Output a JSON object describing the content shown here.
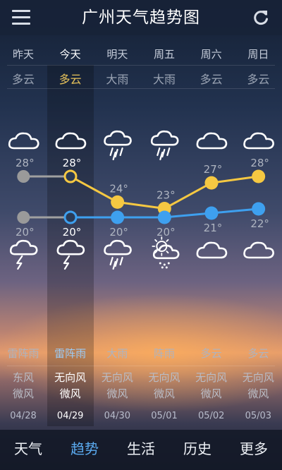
{
  "header": {
    "title": "广州天气趋势图",
    "menu_icon": "menu-icon",
    "refresh_icon": "refresh-icon"
  },
  "days": [
    {
      "name": "昨天",
      "cond_day": "多云",
      "icon_day": "cloud-icon",
      "high": "28°",
      "low": "20°",
      "icon_night": "thunderstorm-icon",
      "cond_night": "雷阵雨",
      "wind_dir": "东风",
      "wind_force": "微风",
      "date": "04/28"
    },
    {
      "name": "今天",
      "cond_day": "多云",
      "icon_day": "cloud-icon",
      "high": "28°",
      "low": "20°",
      "icon_night": "thunderstorm-icon",
      "cond_night": "雷阵雨",
      "wind_dir": "无向风",
      "wind_force": "微风",
      "date": "04/29"
    },
    {
      "name": "明天",
      "cond_day": "大雨",
      "icon_day": "heavy-rain-icon",
      "high": "24°",
      "low": "20°",
      "icon_night": "heavy-rain-icon",
      "cond_night": "大雨",
      "wind_dir": "无向风",
      "wind_force": "微风",
      "date": "04/30"
    },
    {
      "name": "周五",
      "cond_day": "大雨",
      "icon_day": "heavy-rain-icon",
      "high": "23°",
      "low": "20°",
      "icon_night": "shower-icon",
      "cond_night": "阵雨",
      "wind_dir": "无向风",
      "wind_force": "微风",
      "date": "05/01"
    },
    {
      "name": "周六",
      "cond_day": "多云",
      "icon_day": "cloud-icon",
      "high": "27°",
      "low": "21°",
      "icon_night": "cloud-icon",
      "cond_night": "多云",
      "wind_dir": "无向风",
      "wind_force": "微风",
      "date": "05/02"
    },
    {
      "name": "周日",
      "cond_day": "多云",
      "icon_day": "cloud-icon",
      "high": "28°",
      "low": "22°",
      "icon_night": "cloud-icon",
      "cond_night": "多云",
      "wind_dir": "无向风",
      "wind_force": "微风",
      "date": "05/03"
    }
  ],
  "chart_data": {
    "type": "line",
    "categories": [
      "昨天",
      "今天",
      "明天",
      "周五",
      "周六",
      "周日"
    ],
    "series": [
      {
        "values": [
          28,
          28,
          24,
          23,
          27,
          28
        ],
        "color": "#f5c842"
      },
      {
        "values": [
          20,
          20,
          20,
          20,
          21,
          22
        ],
        "color": "#3ea0ef"
      }
    ],
    "past_color": "#a0a0a0",
    "today_index": 1
  },
  "nav": {
    "tabs": [
      {
        "label": "天气"
      },
      {
        "label": "趋势"
      },
      {
        "label": "生活"
      },
      {
        "label": "历史"
      },
      {
        "label": "更多"
      }
    ],
    "active": 1
  }
}
